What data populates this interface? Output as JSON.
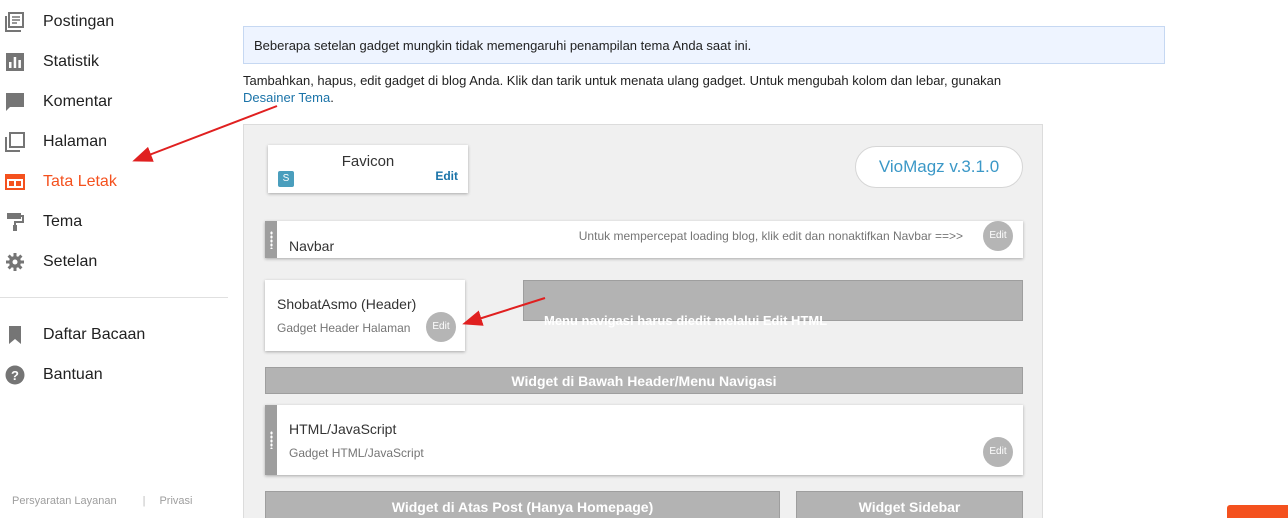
{
  "sidebar": {
    "items": [
      {
        "label": "Postingan",
        "icon": "posts-icon"
      },
      {
        "label": "Statistik",
        "icon": "stats-icon"
      },
      {
        "label": "Komentar",
        "icon": "comment-icon"
      },
      {
        "label": "Halaman",
        "icon": "pages-icon"
      },
      {
        "label": "Tata Letak",
        "icon": "layout-icon",
        "active": true
      },
      {
        "label": "Tema",
        "icon": "paint-roller-icon"
      },
      {
        "label": "Setelan",
        "icon": "gear-icon"
      },
      {
        "label": "Daftar Bacaan",
        "icon": "bookmark-icon"
      },
      {
        "label": "Bantuan",
        "icon": "help-icon"
      }
    ],
    "footer": {
      "terms": "Persyaratan Layanan",
      "privacy": "Privasi"
    }
  },
  "main": {
    "notice": "Beberapa setelan gadget mungkin tidak memengaruhi penampilan tema Anda saat ini.",
    "intro_text": "Tambahkan, hapus, edit gadget di blog Anda. Klik dan tarik untuk menata ulang gadget. Untuk mengubah kolom dan lebar, gunakan",
    "intro_link": "Desainer Tema",
    "intro_end": "."
  },
  "layout": {
    "favicon": {
      "title": "Favicon",
      "edit": "Edit"
    },
    "version": "VioMagz v.3.1.0",
    "navbar": {
      "title": "Navbar",
      "note": "Untuk mempercepat loading blog, klik edit dan nonaktifkan Navbar ==>>",
      "edit": "Edit"
    },
    "header": {
      "title": "ShobatAsmo (Header)",
      "subtitle": "Gadget Header Halaman",
      "edit": "Edit"
    },
    "menu_note": "Menu navigasi harus diedit melalui Edit HTML",
    "below_header": "Widget di Bawah Header/Menu Navigasi",
    "html_gadget": {
      "title": "HTML/JavaScript",
      "subtitle": "Gadget HTML/JavaScript",
      "edit": "Edit"
    },
    "above_post": "Widget di Atas Post (Hanya Homepage)",
    "sidebar_widget": "Widget Sidebar"
  },
  "colors": {
    "accent": "#f4511e",
    "link": "#1a73a8",
    "arrow": "#e02020"
  }
}
